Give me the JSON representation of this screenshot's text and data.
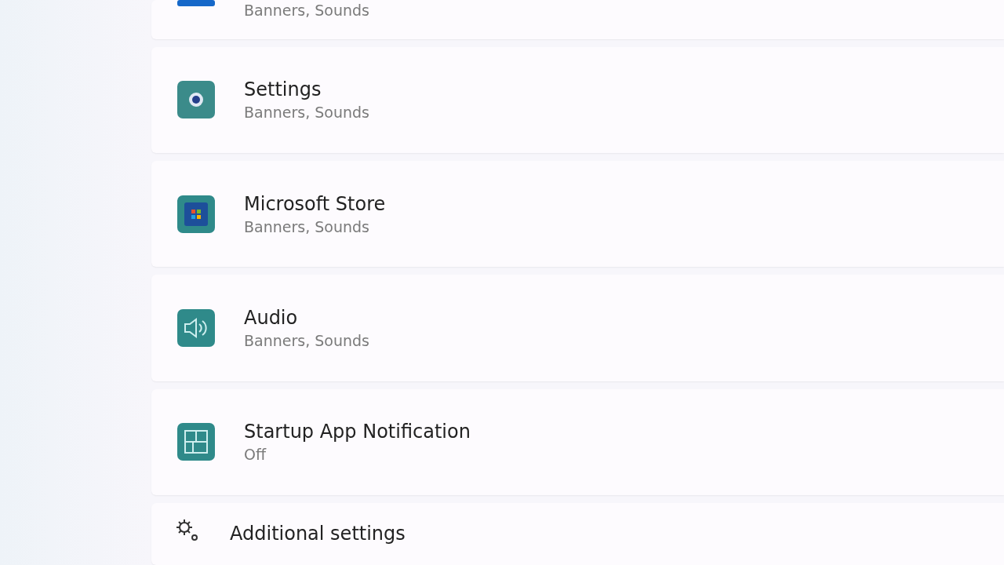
{
  "notifications": [
    {
      "subtitle": "Banners, Sounds"
    },
    {
      "title": "Settings",
      "subtitle": "Banners, Sounds"
    },
    {
      "title": "Microsoft Store",
      "subtitle": "Banners, Sounds"
    },
    {
      "title": "Audio",
      "subtitle": "Banners, Sounds"
    },
    {
      "title": "Startup App Notification",
      "subtitle": "Off"
    }
  ],
  "additional_settings": {
    "title": "Additional settings"
  }
}
